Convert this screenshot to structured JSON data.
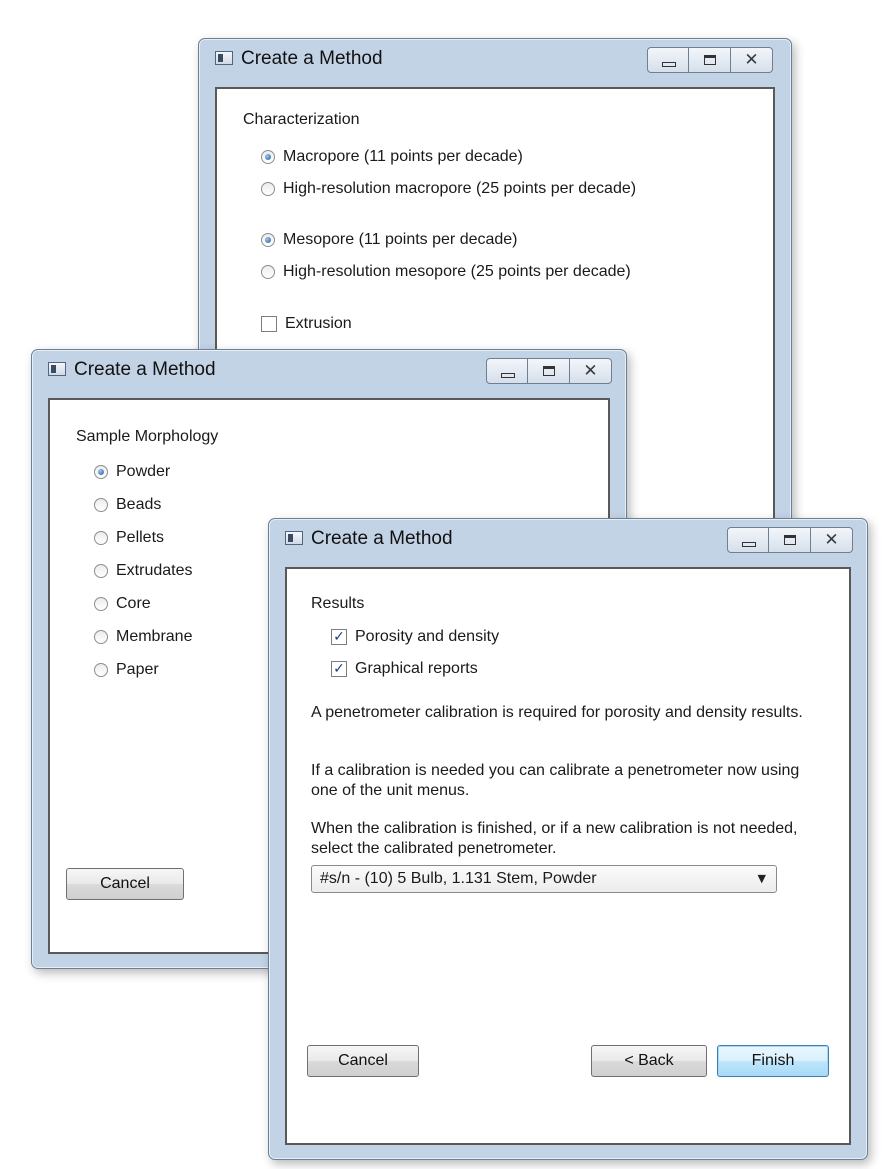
{
  "window_title": "Create a Method",
  "icons": {
    "app": "app-icon",
    "minimize": "minimize-icon",
    "maximize": "maximize-icon",
    "close": "close-icon",
    "dropdown": "chevron-down-icon"
  },
  "close_glyph": "✕",
  "dialog_characterization": {
    "group_label": "Characterization",
    "options": [
      {
        "label": "Macropore (11 points per decade)",
        "selected": true
      },
      {
        "label": "High-resolution macropore (25 points per decade)",
        "selected": false
      },
      {
        "label": "Mesopore (11 points per decade)",
        "selected": true
      },
      {
        "label": "High-resolution mesopore (25 points per decade)",
        "selected": false
      }
    ],
    "extrusion_label": "Extrusion",
    "extrusion_checked": false
  },
  "dialog_morphology": {
    "group_label": "Sample Morphology",
    "options": [
      {
        "label": "Powder",
        "selected": true
      },
      {
        "label": "Beads",
        "selected": false
      },
      {
        "label": "Pellets",
        "selected": false
      },
      {
        "label": "Extrudates",
        "selected": false
      },
      {
        "label": "Core",
        "selected": false
      },
      {
        "label": "Membrane",
        "selected": false
      },
      {
        "label": "Paper",
        "selected": false
      }
    ],
    "cancel_label": "Cancel"
  },
  "dialog_results": {
    "group_label": "Results",
    "checks": [
      {
        "label": "Porosity and density",
        "checked": true,
        "glyph": "✓"
      },
      {
        "label": "Graphical reports",
        "checked": true,
        "glyph": "✓"
      }
    ],
    "paragraph_1": "A penetrometer calibration is required for porosity and density results.",
    "paragraph_2": "If a calibration is needed you can calibrate a penetrometer now using one of the unit menus.",
    "paragraph_3": "When the calibration is finished, or if a new calibration is not needed, select the calibrated penetrometer.",
    "penetrometer_selected": "#s/n - (10)  5 Bulb, 1.131 Stem, Powder",
    "dropdown_arrow": "▼",
    "cancel_label": "Cancel",
    "back_label": "< Back",
    "finish_label": "Finish"
  }
}
